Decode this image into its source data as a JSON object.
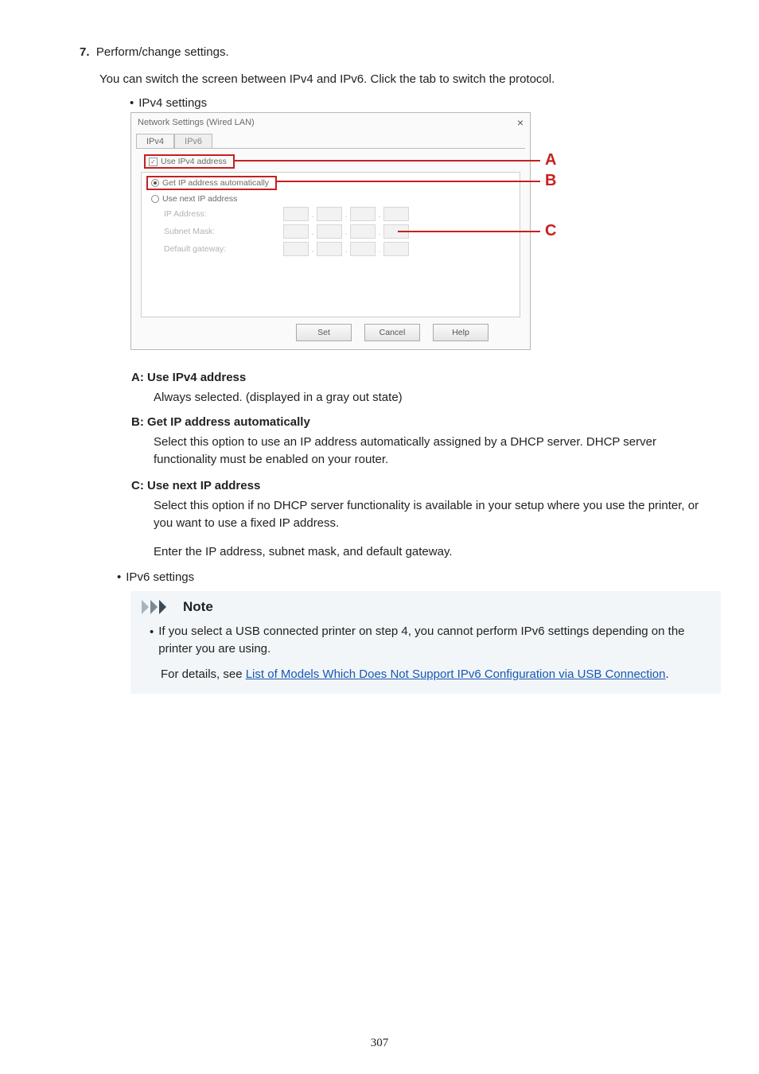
{
  "step": {
    "number": "7.",
    "title": "Perform/change settings."
  },
  "step_desc": "You can switch the screen between IPv4 and IPv6. Click the tab to switch the protocol.",
  "bullet_ipv4": "IPv4 settings",
  "dialog": {
    "title": "Network Settings (Wired LAN)",
    "close": "×",
    "tabs": {
      "ipv4": "IPv4",
      "ipv6": "IPv6"
    },
    "use_ipv4": "Use IPv4 address",
    "get_auto": "Get IP address automatically",
    "use_next": "Use next IP address",
    "ip_label": "IP Address:",
    "mask_label": "Subnet Mask:",
    "gw_label": "Default gateway:",
    "btn_set": "Set",
    "btn_cancel": "Cancel",
    "btn_help": "Help"
  },
  "letters": {
    "a": "A",
    "b": "B",
    "c": "C"
  },
  "def_a": {
    "head": "A: Use IPv4 address",
    "body": "Always selected. (displayed in a gray out state)"
  },
  "def_b": {
    "head": "B: Get IP address automatically",
    "body": "Select this option to use an IP address automatically assigned by a DHCP server. DHCP server functionality must be enabled on your router."
  },
  "def_c": {
    "head": "C: Use next IP address",
    "body": "Select this option if no DHCP server functionality is available in your setup where you use the printer, or you want to use a fixed IP address.",
    "extra": "Enter the IP address, subnet mask, and default gateway."
  },
  "bullet_ipv6": "IPv6 settings",
  "note": {
    "title": "Note",
    "line1": "If you select a USB connected printer on step 4, you cannot perform IPv6 settings depending on the printer you are using.",
    "line2_pre": "For details, see ",
    "line2_link": "List of Models Which Does Not Support IPv6 Configuration via USB Connection",
    "line2_post": "."
  },
  "page_number": "307"
}
